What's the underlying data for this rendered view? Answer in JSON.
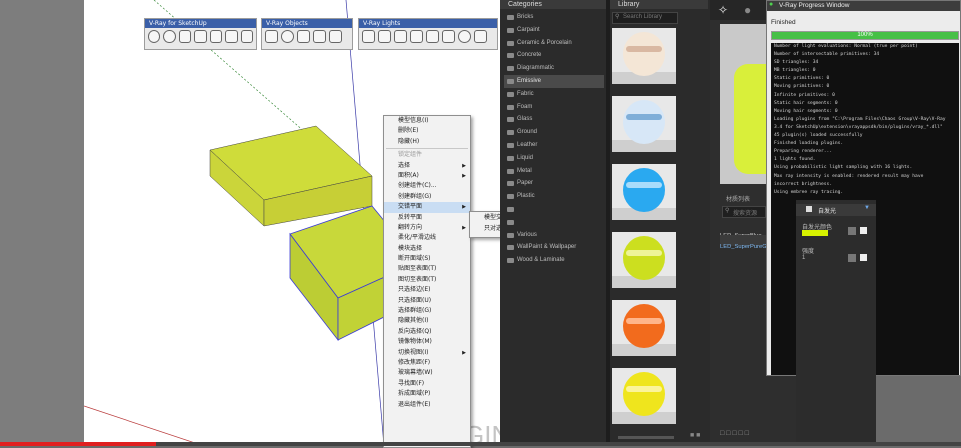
{
  "sketchup": {
    "toolbars": [
      {
        "title": "V-Ray for SketchUp"
      },
      {
        "title": "V-Ray Objects"
      },
      {
        "title": "V-Ray Lights"
      }
    ],
    "context_menu": {
      "items": [
        {
          "label": "模型信息(I)",
          "disabled": false,
          "sub": false
        },
        {
          "label": "删除(E)",
          "disabled": false,
          "sub": false
        },
        {
          "label": "隐藏(H)",
          "disabled": false,
          "sub": false
        },
        {
          "label": "锁定组件",
          "disabled": true,
          "sub": false
        },
        {
          "label": "选择",
          "disabled": false,
          "sub": true
        },
        {
          "label": "面积(A)",
          "disabled": false,
          "sub": true
        },
        {
          "label": "创建组件(C)...",
          "disabled": false,
          "sub": false
        },
        {
          "label": "创建群组(G)",
          "disabled": false,
          "sub": false
        },
        {
          "label": "交错平面",
          "disabled": false,
          "sub": true,
          "highlight": true
        },
        {
          "label": "反转平面",
          "disabled": false,
          "sub": false
        },
        {
          "label": "翻转方向",
          "disabled": false,
          "sub": true
        },
        {
          "label": "柔化/平滑边线",
          "disabled": false,
          "sub": false
        },
        {
          "label": "模块选择",
          "disabled": false,
          "sub": false
        },
        {
          "label": "断开面域(S)",
          "disabled": false,
          "sub": false
        },
        {
          "label": "贴图至表面(T)",
          "disabled": false,
          "sub": false
        },
        {
          "label": "图切至表面(T)",
          "disabled": false,
          "sub": false
        },
        {
          "label": "只选择边(E)",
          "disabled": false,
          "sub": false
        },
        {
          "label": "只选择面(U)",
          "disabled": false,
          "sub": false
        },
        {
          "label": "选择群组(G)",
          "disabled": false,
          "sub": false
        },
        {
          "label": "隐藏其他(I)",
          "disabled": false,
          "sub": false
        },
        {
          "label": "反向选择(Q)",
          "disabled": false,
          "sub": false
        },
        {
          "label": "镜像物体(M)",
          "disabled": false,
          "sub": false
        },
        {
          "label": "切换视图(I)",
          "disabled": false,
          "sub": true
        },
        {
          "label": "修改焦距(F)",
          "disabled": false,
          "sub": false
        },
        {
          "label": "玻璃幕墙(W)",
          "disabled": false,
          "sub": false
        },
        {
          "label": "寻找面(F)",
          "disabled": false,
          "sub": false
        },
        {
          "label": "拆成面域(P)",
          "disabled": false,
          "sub": false
        },
        {
          "label": "退出组件(E)",
          "disabled": false,
          "sub": false
        }
      ]
    },
    "submenu": {
      "items": [
        "模型交错",
        "只对选择对象交错"
      ]
    },
    "watermark": "GINA"
  },
  "library": {
    "categories_header": "Categories",
    "library_header": "Library",
    "search_placeholder": "Search Library",
    "categories": [
      "Bricks",
      "Carpaint",
      "Ceramic & Porcelain",
      "Concrete",
      "Diagrammatic",
      "Emissive",
      "Fabric",
      "Foam",
      "Glass",
      "Ground",
      "Leather",
      "Liquid",
      "Metal",
      "Paper",
      "Plastic",
      "",
      "",
      "Various",
      "WallPaint & Wallpaper",
      "Wood & Laminate"
    ],
    "selected_category": "Emissive",
    "thumbnails": [
      {
        "color": "#f4e6d6",
        "band": "#d9b8a2"
      },
      {
        "color": "#d7e7f7",
        "band": "#7faed8"
      },
      {
        "color": "#2aa9f0",
        "band": "#a8dcfb"
      },
      {
        "color": "#ccdf1f",
        "band": "#eef497"
      },
      {
        "color": "#f26b1d",
        "band": "#ffb58a"
      },
      {
        "color": "#efe51d",
        "band": "#fbf49a"
      }
    ]
  },
  "vray_editor": {
    "materials_label": "材质列表",
    "search_placeholder": "搜索资源",
    "materials": [
      "LED_SuperBlue",
      "LED_SuperPureGreen"
    ],
    "selected_material": "LED_SuperPureGreen"
  },
  "progress_window": {
    "title": "V-Ray Progress Window",
    "status": "Finished",
    "percent": 100,
    "percent_label": "100%",
    "accent": "#46c046",
    "log": [
      "Number of light evaluations: Normal (true per point)",
      "Number of intersectable primitives: 34",
      "SD triangles: 34",
      "MB triangles: 0",
      "Static primitives: 0",
      "Moving primitives: 0",
      "Infinite primitives: 0",
      "Static hair segments: 0",
      "Moving hair segments: 0",
      "Loading plugins from \"C:\\Program Files\\Chaos Group\\V-Ray\\V-Ray",
      "3.4 for SketchUp\\extension\\vrayappsdk/bin/plugins/vray_*.dll\"",
      "45 plugin(s) loaded successfully",
      "Finished loading plugins.",
      "Preparing renderer...",
      "1 lights found.",
      "Using probabilistic light sampling with 16 lights.",
      "Max ray intensity is enabled: rendered result may have",
      "incorrect brightness.",
      "Using embree ray tracing."
    ]
  },
  "props": {
    "title": "自发光",
    "color_label": "自发光颜色",
    "intensity_label": "强度",
    "intensity_value": "1",
    "swatch_color": "#d7f200"
  }
}
